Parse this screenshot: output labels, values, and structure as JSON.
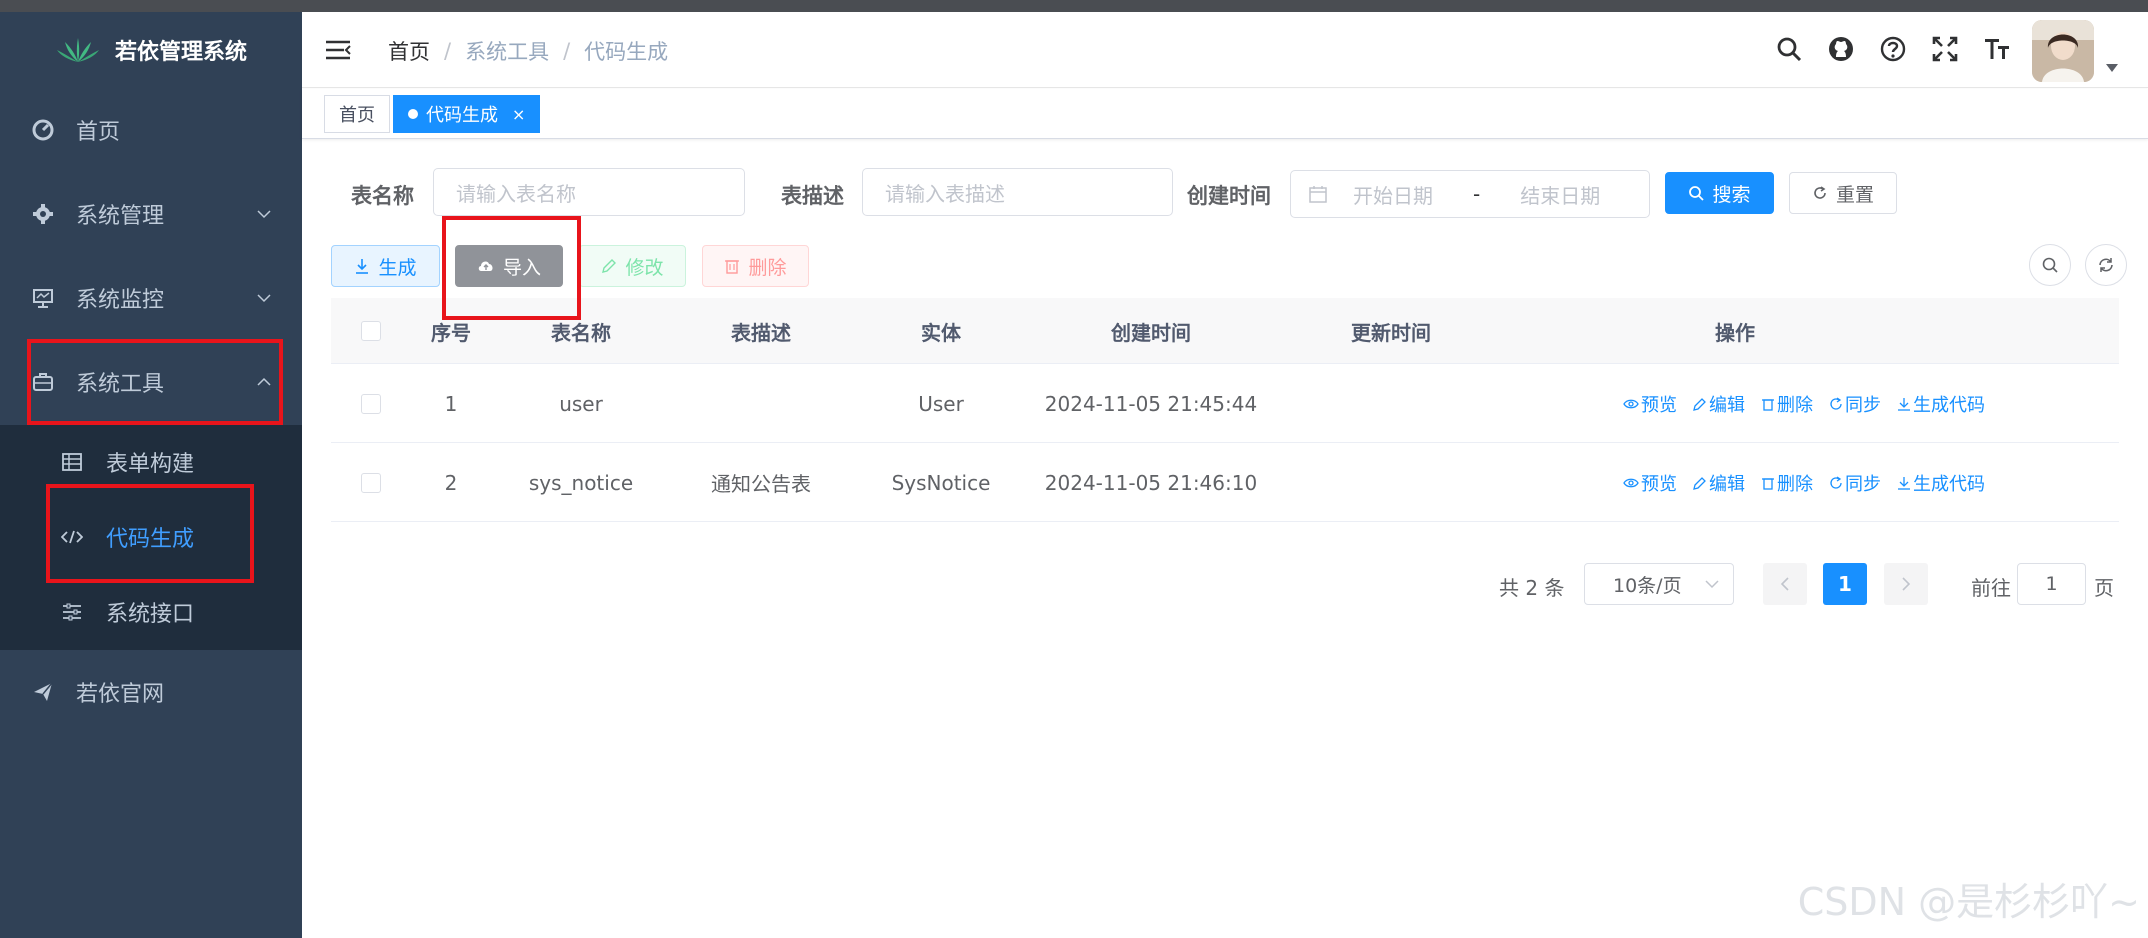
{
  "app": {
    "title": "若依管理系统"
  },
  "sidebar": {
    "items": [
      {
        "label": "首页",
        "icon": "dashboard-icon"
      },
      {
        "label": "系统管理",
        "icon": "gear-icon"
      },
      {
        "label": "系统监控",
        "icon": "monitor-icon"
      },
      {
        "label": "系统工具",
        "icon": "toolbox-icon"
      },
      {
        "label": "若依官网",
        "icon": "paper-plane-icon"
      }
    ],
    "tools_children": [
      {
        "label": "表单构建",
        "icon": "table-grid-icon"
      },
      {
        "label": "代码生成",
        "icon": "code-icon"
      },
      {
        "label": "系统接口",
        "icon": "sliders-icon"
      }
    ]
  },
  "navbar": {
    "breadcrumb": [
      "首页",
      "系统工具",
      "代码生成"
    ],
    "separator": "/"
  },
  "tags": [
    {
      "label": "首页"
    },
    {
      "label": "代码生成",
      "close": "×"
    }
  ],
  "search": {
    "table_name_label": "表名称",
    "table_name_placeholder": "请输入表名称",
    "table_desc_label": "表描述",
    "table_desc_placeholder": "请输入表描述",
    "create_time_label": "创建时间",
    "start_placeholder": "开始日期",
    "range_separator": "-",
    "end_placeholder": "结束日期",
    "search_label": "搜索",
    "reset_label": "重置"
  },
  "toolbar": {
    "generate_label": "生成",
    "import_label": "导入",
    "edit_label": "修改",
    "delete_label": "删除"
  },
  "table": {
    "columns": [
      "序号",
      "表名称",
      "表描述",
      "实体",
      "创建时间",
      "更新时间",
      "操作"
    ],
    "rows": [
      {
        "index": "1",
        "table_name": "user",
        "table_desc": "",
        "entity": "User",
        "create_time": "2024-11-05 21:45:44",
        "update_time": ""
      },
      {
        "index": "2",
        "table_name": "sys_notice",
        "table_desc": "通知公告表",
        "entity": "SysNotice",
        "create_time": "2024-11-05 21:46:10",
        "update_time": ""
      }
    ],
    "actions": [
      "预览",
      "编辑",
      "删除",
      "同步",
      "生成代码"
    ]
  },
  "pagination": {
    "total_text": "共 2 条",
    "page_size": "10条/页",
    "current_page": "1",
    "goto_prefix": "前往",
    "goto_value": "1",
    "goto_suffix": "页"
  },
  "watermark": "CSDN @是杉杉吖~",
  "colors": {
    "sidebar": "#304156",
    "submenu": "#1f2d3d",
    "primary": "#1890ff",
    "highlight_box": "#e8141b"
  }
}
